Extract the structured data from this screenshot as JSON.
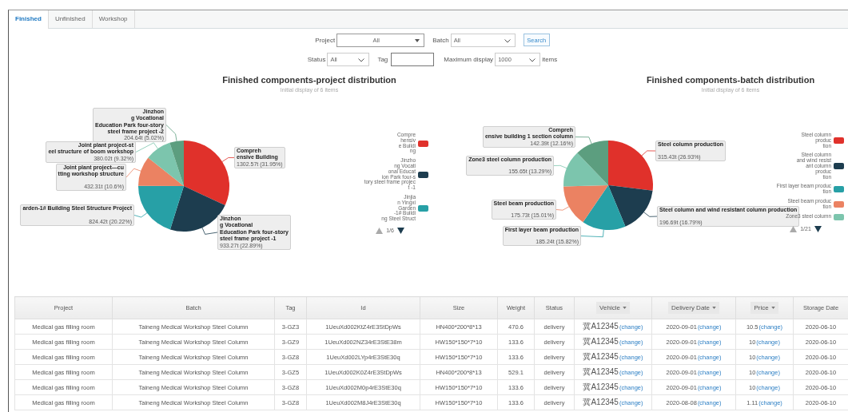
{
  "tabs": [
    {
      "label": "Finished",
      "selected": true
    },
    {
      "label": "Unfinished",
      "selected": false
    },
    {
      "label": "Workshop",
      "selected": false
    }
  ],
  "filters": {
    "project": {
      "label": "Project",
      "value": "All"
    },
    "batch": {
      "label": "Batch",
      "value": "All"
    },
    "search_button": "Search",
    "status": {
      "label": "Status",
      "value": "All"
    },
    "tag": {
      "label": "Tag"
    },
    "max_display": {
      "label": "Maximum display",
      "value": "1000",
      "unit": "items"
    }
  },
  "charts": [
    {
      "title": "Finished components-project distribution",
      "subtitle": "Initial display of 6 items",
      "chart_data": {
        "type": "pie",
        "categories": [
          "Compreh\nensive Building",
          "Jinzhon\ng Vocational\nEducation Park four-story\nsteel frame project -1",
          "arden-1# Building Steel Structure Project",
          "Joint plant project—cu\ntting workshop structure",
          "Joint plant project-st\neel structure of boom workshop",
          "Jinzhon\ng Vocational\nEducation Park four-story\nsteel frame project -2"
        ],
        "values": [
          31.95,
          22.89,
          20.22,
          10.6,
          9.32,
          5.02
        ],
        "colors": [
          "#e0312b",
          "#1d3d4f",
          "#27a0a6",
          "#eb8262",
          "#7cc5ad",
          "#5c9e7f"
        ],
        "value_labels": [
          "1302.57t (31.95%)",
          "933.27t (22.89%)",
          "824.42t (20.22%)",
          "432.31t (10.6%)",
          "380.02t (9.32%)",
          "204.64t (5.02%)"
        ]
      },
      "legend": {
        "items": [
          {
            "label": "Compre\nhensiv\ne Buildi\nng",
            "color": "#e0312b"
          },
          {
            "label": "Jinzho\nng Vocati\nonal Educat\nion Park four-s\ntory steel frame projec\nt -1",
            "color": "#1d3d4f"
          },
          {
            "label": "Jinjia\nn Yingxi\nGarden\n-1# Buildi\nng Steel Struct",
            "color": "#27a0a6"
          }
        ],
        "pager": "1/6"
      }
    },
    {
      "title": "Finished components-batch distribution",
      "subtitle": "Initial display of 6 items",
      "chart_data": {
        "type": "pie",
        "categories": [
          "Steel column production",
          "Steel column and wind resistant column production",
          "First layer beam production",
          "Steel beam production",
          "Zone3 steel column production",
          "Compreh\nensive building 1 section column"
        ],
        "values": [
          26.93,
          16.79,
          15.82,
          15.01,
          13.29,
          12.16
        ],
        "colors": [
          "#e0312b",
          "#1d3d4f",
          "#27a0a6",
          "#eb8262",
          "#7cc5ad",
          "#5c9e7f"
        ],
        "value_labels": [
          "315.43t (26.93%)",
          "196.69t (16.79%)",
          "185.24t (15.82%)",
          "175.73t (15.01%)",
          "155.65t (13.29%)",
          "142.39t (12.16%)"
        ]
      },
      "legend": {
        "items": [
          {
            "label": "Steel column\nproduc\ntion",
            "color": "#e0312b"
          },
          {
            "label": "Steel column\nand wind resist\nant column\nproduc\ntion",
            "color": "#1d3d4f"
          },
          {
            "label": "First layer beam produc\ntion",
            "color": "#27a0a6"
          },
          {
            "label": "Steel beam produc\ntion",
            "color": "#eb8262"
          },
          {
            "label": "Zone3 steel column",
            "color": "#7cc5ad"
          }
        ],
        "pager": "1/21"
      }
    }
  ],
  "table": {
    "columns": [
      {
        "label": "Project",
        "kind": "plain"
      },
      {
        "label": "Batch",
        "kind": "plain"
      },
      {
        "label": "Tag",
        "kind": "plain"
      },
      {
        "label": "Id",
        "kind": "plain"
      },
      {
        "label": "Size",
        "kind": "plain"
      },
      {
        "label": "Weight",
        "kind": "plain"
      },
      {
        "label": "Status",
        "kind": "plain"
      },
      {
        "label": "Vehicle",
        "kind": "menu"
      },
      {
        "label": "Delivery Date",
        "kind": "menu"
      },
      {
        "label": "Price",
        "kind": "menu"
      },
      {
        "label": "Storage Date",
        "kind": "plain"
      }
    ],
    "rows": [
      {
        "project": "Medical gas filling room",
        "batch": "Taineng Medical Workshop Steel Column",
        "tag": "3-GZ3",
        "id": "1UeuXd002KtZ4rE3StDpWs",
        "size": "HN400*200*8*13",
        "weight": "470.6",
        "status": "delivery",
        "vehicle": {
          "value": "冀A12345",
          "link": "(change)"
        },
        "delivery_date": {
          "value": "2020-09-01",
          "link": "(change)"
        },
        "price": {
          "value": "10.5",
          "link": "(change)"
        },
        "storage_date": "2020-06-10"
      },
      {
        "project": "Medical gas filling room",
        "batch": "Taineng Medical Workshop Steel Column",
        "tag": "3-GZ9",
        "id": "1UeuXd002NZ34rE3StE38m",
        "size": "HW150*150*7*10",
        "weight": "133.6",
        "status": "delivery",
        "vehicle": {
          "value": "冀A12345",
          "link": "(change)"
        },
        "delivery_date": {
          "value": "2020-09-01",
          "link": "(change)"
        },
        "price": {
          "value": "10",
          "link": "(change)"
        },
        "storage_date": "2020-06-10"
      },
      {
        "project": "Medical gas filling room",
        "batch": "Taineng Medical Workshop Steel Column",
        "tag": "3-GZ8",
        "id": "1UeuXd002LYp4rE3StE30q",
        "size": "HW150*150*7*10",
        "weight": "133.6",
        "status": "delivery",
        "vehicle": {
          "value": "冀A12345",
          "link": "(change)"
        },
        "delivery_date": {
          "value": "2020-09-01",
          "link": "(change)"
        },
        "price": {
          "value": "10",
          "link": "(change)"
        },
        "storage_date": "2020-06-10"
      },
      {
        "project": "Medical gas filling room",
        "batch": "Taineng Medical Workshop Steel Column",
        "tag": "3-GZ5",
        "id": "1UeuXd002K0Z4rE3StDpWs",
        "size": "HN400*200*8*13",
        "weight": "529.1",
        "status": "delivery",
        "vehicle": {
          "value": "冀A12345",
          "link": "(change)"
        },
        "delivery_date": {
          "value": "2020-09-01",
          "link": "(change)"
        },
        "price": {
          "value": "10",
          "link": "(change)"
        },
        "storage_date": "2020-06-10"
      },
      {
        "project": "Medical gas filling room",
        "batch": "Taineng Medical Workshop Steel Column",
        "tag": "3-GZ8",
        "id": "1UeuXd002M0p4rE3StE30q",
        "size": "HW150*150*7*10",
        "weight": "133.6",
        "status": "delivery",
        "vehicle": {
          "value": "冀A12345",
          "link": "(change)"
        },
        "delivery_date": {
          "value": "2020-09-01",
          "link": "(change)"
        },
        "price": {
          "value": "10",
          "link": "(change)"
        },
        "storage_date": "2020-06-10"
      },
      {
        "project": "Medical gas filling room",
        "batch": "Taineng Medical Workshop Steel Column",
        "tag": "3-GZ8",
        "id": "1UeuXd002M8J4rE3StE30q",
        "size": "HW150*150*7*10",
        "weight": "133.6",
        "status": "delivery",
        "vehicle": {
          "value": "冀A12345",
          "link": "(change)"
        },
        "delivery_date": {
          "value": "2020-08-08",
          "link": "(change)"
        },
        "price": {
          "value": "1.11",
          "link": "(change)"
        },
        "storage_date": "2020-06-10"
      }
    ]
  }
}
